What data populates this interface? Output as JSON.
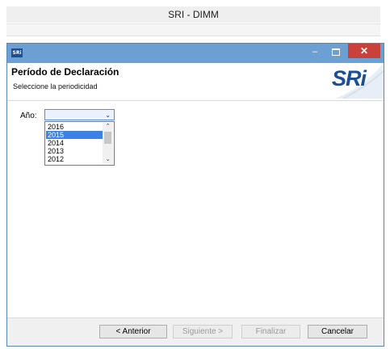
{
  "app": {
    "title": "SRI - DIMM"
  },
  "dialog": {
    "icon_text": "SRi",
    "controls": {
      "minimize": "–",
      "close": "✕"
    },
    "header": {
      "title": "Período de Declaración",
      "subtitle": "Seleccione la periodicidad",
      "logo": "SRi"
    },
    "form": {
      "year_label": "Año:",
      "year_value": "",
      "year_options": [
        "2016",
        "2015",
        "2014",
        "2013",
        "2012"
      ],
      "highlighted_option": "2015"
    },
    "buttons": {
      "back": "< Anterior",
      "next": "Siguiente >",
      "finish": "Finalizar",
      "cancel": "Cancelar"
    }
  },
  "colors": {
    "titlebar": "#6c9fd2",
    "close_button": "#c9413a",
    "highlight": "#3c82e2",
    "logo": "#1b4f91"
  }
}
